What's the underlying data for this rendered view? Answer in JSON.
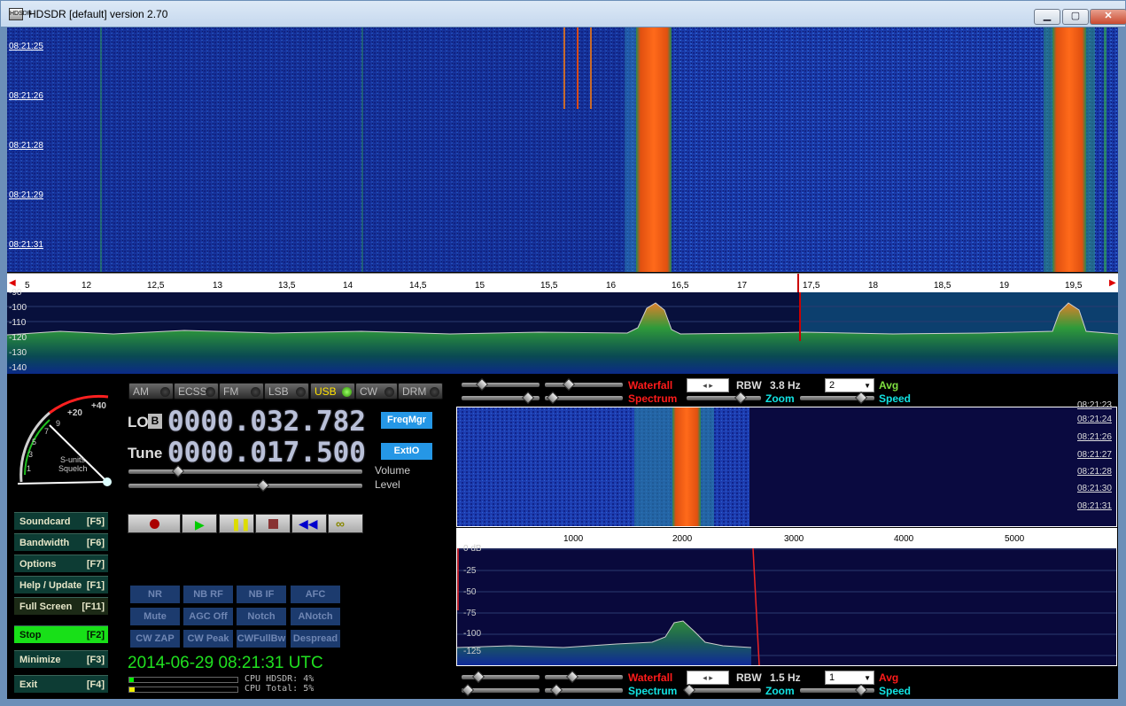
{
  "window": {
    "title": "HDSDR [default]  version 2.70",
    "icon_text": "HDSDR",
    "min": "▁",
    "max": "▢",
    "close": "✕"
  },
  "waterfall": {
    "timestamps": [
      "08:21:25",
      "08:21:26",
      "08:21:28",
      "08:21:29",
      "08:21:31"
    ]
  },
  "freq_axis": {
    "ticks": [
      "5",
      "12",
      "12,5",
      "13",
      "13,5",
      "14",
      "14,5",
      "15",
      "15,5",
      "16",
      "16,5",
      "17",
      "17,5",
      "18",
      "18,5",
      "19",
      "19,5"
    ]
  },
  "spectrum": {
    "db_labels": [
      "-90",
      "-100",
      "-110",
      "-120",
      "-130",
      "-140"
    ]
  },
  "modes": [
    {
      "label": "AM",
      "active": false
    },
    {
      "label": "ECSS",
      "active": false
    },
    {
      "label": "FM",
      "active": false
    },
    {
      "label": "LSB",
      "active": false
    },
    {
      "label": "USB",
      "active": true
    },
    {
      "label": "CW",
      "active": false
    },
    {
      "label": "DRM",
      "active": false
    }
  ],
  "lo": {
    "label": "LO",
    "badge": "B",
    "value": "0000.032.782"
  },
  "tune": {
    "label": "Tune",
    "value": "0000.017.500"
  },
  "buttons": {
    "freqmgr": "FreqMgr",
    "extio": "ExtIO"
  },
  "sliders": {
    "volume": "Volume",
    "level": "Level",
    "volume_value": 0.2,
    "level_value": 0.58
  },
  "smeter": {
    "scale": [
      "1",
      "3",
      "5",
      "7",
      "9",
      "+20",
      "+40"
    ],
    "label1": "S-units",
    "label2": "Squelch"
  },
  "side_buttons": [
    {
      "label": "Soundcard",
      "key": "[F5]"
    },
    {
      "label": "Bandwidth",
      "key": "[F6]"
    },
    {
      "label": "Options",
      "key": "[F7]"
    },
    {
      "label": "Help / Update",
      "key": "[F1]"
    },
    {
      "label": "Full Screen",
      "key": "[F11]"
    },
    {
      "label": "Stop",
      "key": "[F2]"
    },
    {
      "label": "Minimize",
      "key": "[F3]"
    },
    {
      "label": "Exit",
      "key": "[F4]"
    }
  ],
  "dsp_buttons": [
    "NR",
    "NB RF",
    "NB IF",
    "AFC",
    "Mute",
    "AGC Off",
    "Notch",
    "ANotch",
    "CW ZAP",
    "CW Peak",
    "CWFullBw",
    "Despread"
  ],
  "status": {
    "datetime": "2014-06-29   08:21:31 UTC",
    "cpu_hdsdr": "CPU HDSDR:  4%",
    "cpu_total": "CPU Total:  5%"
  },
  "top_controls": {
    "waterfall": "Waterfall",
    "spectrum": "Spectrum",
    "rbw_label": "RBW",
    "rbw_value": "3.8 Hz",
    "avg_value": "2",
    "avg": "Avg",
    "zoom": "Zoom",
    "speed": "Speed",
    "spin": "◂ ▸"
  },
  "audio_waterfall": {
    "timestamps": [
      "08:21:23",
      "08:21:24",
      "08:21:26",
      "08:21:27",
      "08:21:28",
      "08:21:30",
      "08:21:31"
    ]
  },
  "audio_axis": {
    "ticks": [
      "1000",
      "2000",
      "3000",
      "4000",
      "5000"
    ]
  },
  "audio_spectrum": {
    "db_labels": [
      "0 dB",
      "-25",
      "-50",
      "-75",
      "-100",
      "-125"
    ]
  },
  "bottom_controls": {
    "waterfall": "Waterfall",
    "spectrum": "Spectrum",
    "rbw_label": "RBW",
    "rbw_value": "1.5 Hz",
    "avg_value": "1",
    "avg": "Avg",
    "zoom": "Zoom",
    "speed": "Speed",
    "spin": "◂ ▸"
  },
  "colors": {
    "accent_blue": "#2597e6",
    "active_green": "#18e018",
    "clock_green": "#20e020",
    "label_red": "#ff1b1b",
    "label_cyan": "#12e3e3"
  }
}
